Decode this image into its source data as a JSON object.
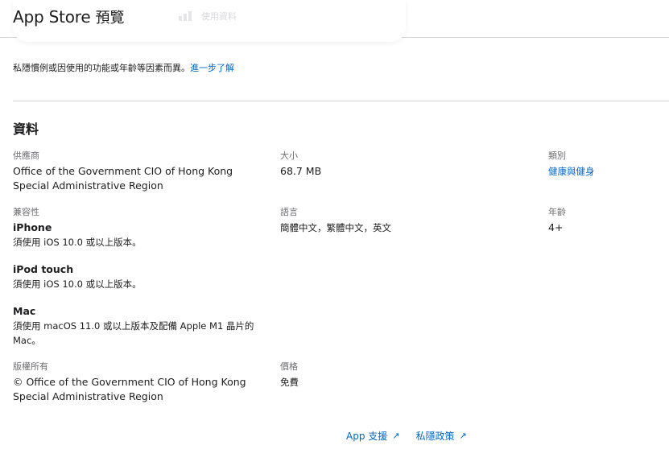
{
  "header": {
    "brand_main": "App Store",
    "brand_sub": "預覽",
    "faded_label": "使用資料"
  },
  "privacy": {
    "note": "私隱慣例或因使用的功能或年齡等因素而異。",
    "link": "進一步了解"
  },
  "info": {
    "title": "資料",
    "provider": {
      "label": "供應商",
      "value": "Office of the Government CIO of Hong Kong Special Administrative Region"
    },
    "size": {
      "label": "大小",
      "value": "68.7 MB"
    },
    "category": {
      "label": "類別",
      "value": "健康與健身"
    },
    "compatibility": {
      "label": "兼容性",
      "devices": [
        {
          "name": "iPhone",
          "requirement": "須使用 iOS 10.0 或以上版本。"
        },
        {
          "name": "iPod touch",
          "requirement": "須使用 iOS 10.0 或以上版本。"
        },
        {
          "name": "Mac",
          "requirement": "須使用 macOS 11.0 或以上版本及配備 Apple M1 晶片的 Mac。"
        }
      ]
    },
    "language": {
      "label": "語言",
      "value": "簡體中文，繁體中文，英文"
    },
    "age": {
      "label": "年齡",
      "value": "4+"
    },
    "copyright": {
      "label": "版權所有",
      "value": "© Office of the Government CIO of Hong Kong Special Administrative Region"
    },
    "price": {
      "label": "價格",
      "value": "免費"
    }
  },
  "footer": {
    "support_link": "App 支援",
    "privacy_link": "私隱政策",
    "arrow_icon": "↗"
  },
  "icons": {
    "bar_chart": "bar-chart-icon",
    "external_link": "external-link-icon"
  },
  "colors": {
    "link": "#0066cc",
    "text": "#1d1d1f",
    "label": "#6e6e73",
    "divider": "#d2d2d7"
  }
}
